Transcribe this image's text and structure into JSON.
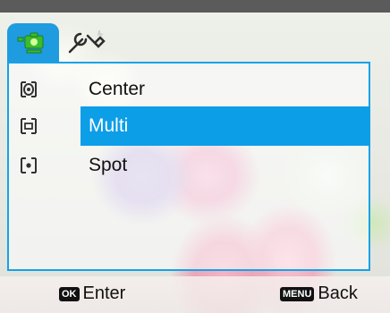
{
  "tabs": [
    {
      "icon": "camera-mode-icon",
      "active": true
    },
    {
      "icon": "setup-wrench-icon",
      "active": false
    }
  ],
  "menu": {
    "items": [
      {
        "label": "Center",
        "icon": "center-metering-icon",
        "selected": false
      },
      {
        "label": "Multi",
        "icon": "multi-metering-icon",
        "selected": true
      },
      {
        "label": "Spot",
        "icon": "spot-metering-icon",
        "selected": false
      }
    ]
  },
  "footer": {
    "ok_key": "OK",
    "ok_label": "Enter",
    "menu_key": "MENU",
    "menu_label": "Back"
  },
  "colors": {
    "accent": "#0d9ee8",
    "panel_border": "#16a2e8",
    "tab_active": "#1f9be0",
    "top_bar": "#5b5b5b"
  }
}
